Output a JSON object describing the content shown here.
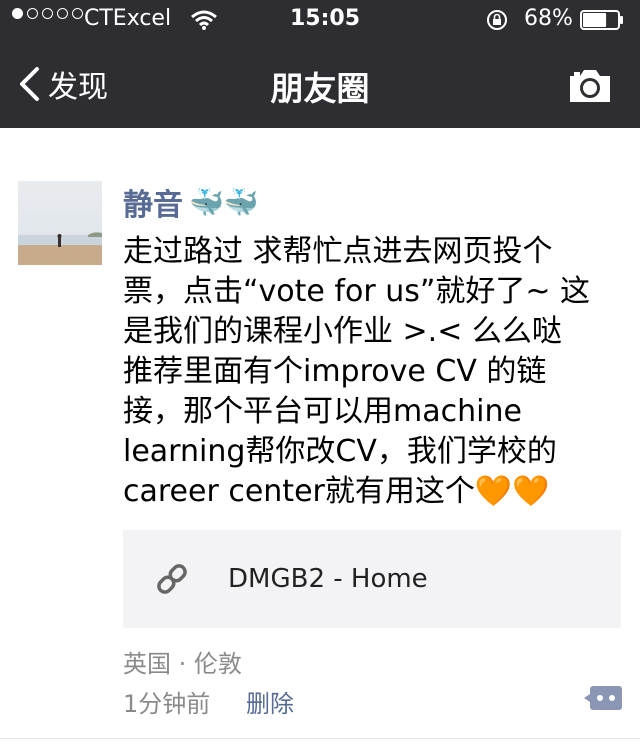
{
  "status_bar": {
    "signal_filled": 1,
    "signal_total": 5,
    "carrier": "CTExcel",
    "time": "15:05",
    "battery_percent": "68%",
    "battery_level": 0.68
  },
  "nav": {
    "back_label": "发现",
    "title": "朋友圈",
    "back_icon": "chevron-left-icon",
    "camera_icon": "camera-icon"
  },
  "post": {
    "author": "静音",
    "emoji": "🐳🐳",
    "text": "走过路过 求帮忙点进去网页投个\n票，点击“vote for us”就好了~ 这\n是我们的课程小作业 >.< 么么哒\n推荐里面有个improve CV 的链\n接，那个平台可以用machine\nlearning帮你改CV，我们学校的\ncareer center就有用这个🧡🧡",
    "link": {
      "icon": "link-icon",
      "title": "DMGB2 - Home"
    },
    "location": "英国 · 伦敦",
    "time_ago": "1分钟前",
    "delete_label": "删除",
    "comment_icon": "comment-bubble-icon"
  },
  "colors": {
    "nav_bg": "#2e2d32",
    "name_blue": "#576b95",
    "meta_gray": "#8a8a8a",
    "card_bg": "#f3f3f5"
  }
}
